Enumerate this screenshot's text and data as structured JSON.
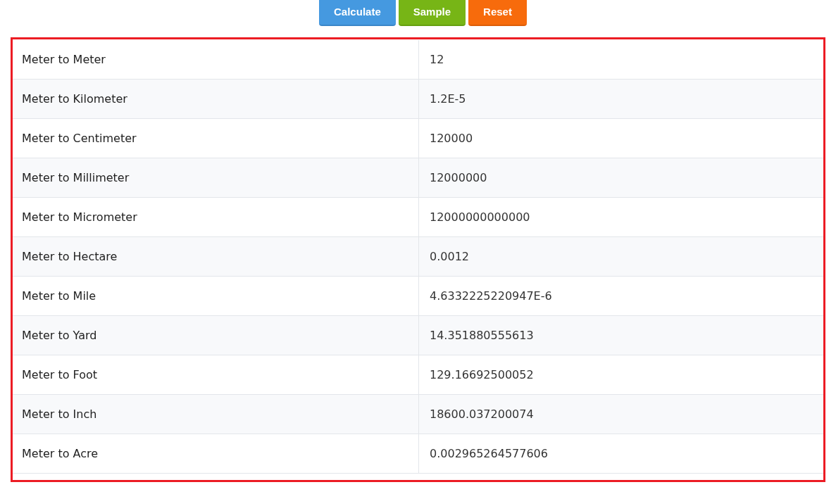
{
  "buttons": [
    {
      "label": "Calculate",
      "kind": "primary"
    },
    {
      "label": "Sample",
      "kind": "success"
    },
    {
      "label": "Reset",
      "kind": "warning"
    }
  ],
  "results": [
    {
      "name": "Meter to Meter",
      "value": "12"
    },
    {
      "name": "Meter to Kilometer",
      "value": "1.2E-5"
    },
    {
      "name": "Meter to Centimeter",
      "value": "120000"
    },
    {
      "name": "Meter to Millimeter",
      "value": "12000000"
    },
    {
      "name": "Meter to Micrometer",
      "value": "12000000000000"
    },
    {
      "name": "Meter to Hectare",
      "value": "0.0012"
    },
    {
      "name": "Meter to Mile",
      "value": "4.6332225220947E-6"
    },
    {
      "name": "Meter to Yard",
      "value": "14.351880555613"
    },
    {
      "name": "Meter to Foot",
      "value": "129.16692500052"
    },
    {
      "name": "Meter to Inch",
      "value": "18600.037200074"
    },
    {
      "name": "Meter to Acre",
      "value": "0.002965264577606"
    }
  ]
}
